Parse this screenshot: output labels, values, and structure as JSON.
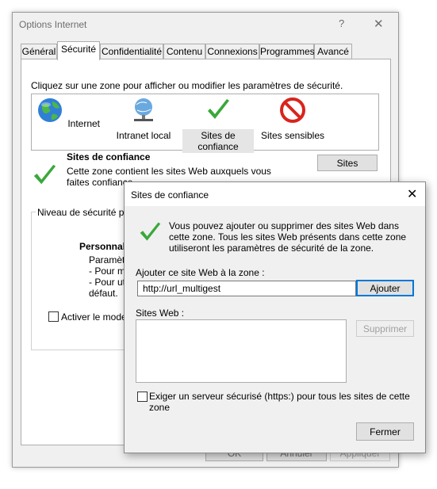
{
  "main": {
    "title": "Options Internet",
    "help": "?",
    "close": "✕",
    "tabs": [
      "Général",
      "Sécurité",
      "Confidentialité",
      "Contenu",
      "Connexions",
      "Programmes",
      "Avancé"
    ],
    "active_tab": "Sécurité",
    "zone_prompt": "Cliquez sur une zone pour afficher ou modifier les paramètres de sécurité.",
    "zones": [
      {
        "label": "Internet",
        "icon": "globe-icon"
      },
      {
        "label": "Intranet local",
        "icon": "network-globe-icon"
      },
      {
        "label": "Sites de confiance",
        "icon": "checkmark-icon",
        "selected": true
      },
      {
        "label": "Sites sensibles",
        "icon": "restricted-icon"
      }
    ],
    "zone_name": "Sites de confiance",
    "zone_desc": "Cette zone contient les sites Web auxquels vous faites confiance.",
    "sites_button": "Sites",
    "security_legend": "Niveau de sécurité pou",
    "security_level": "Personnal",
    "security_lines": [
      "Paramètr",
      "- Pour mo",
      "- Pour uti",
      "défaut."
    ],
    "advanced_label": "Activer le mode p",
    "ok": "OK",
    "cancel": "Annuler",
    "apply": "Appliquer"
  },
  "dialog": {
    "title": "Sites de confiance",
    "close": "✕",
    "info": "Vous pouvez ajouter ou supprimer des sites Web dans cette zone. Tous les sites Web présents dans cette zone utiliseront les paramètres de sécurité de la zone.",
    "add_label": "Ajouter ce site Web à la zone :",
    "url_value": "http://url_multigest",
    "add_button": "Ajouter",
    "sites_label": "Sites Web :",
    "remove_button": "Supprimer",
    "https_label": "Exiger un serveur sécurisé (https:) pour tous les sites de cette zone",
    "close_button": "Fermer"
  },
  "colors": {
    "accent": "#0078d7",
    "check_green": "#3aa83a",
    "restricted_red": "#d9241c"
  }
}
